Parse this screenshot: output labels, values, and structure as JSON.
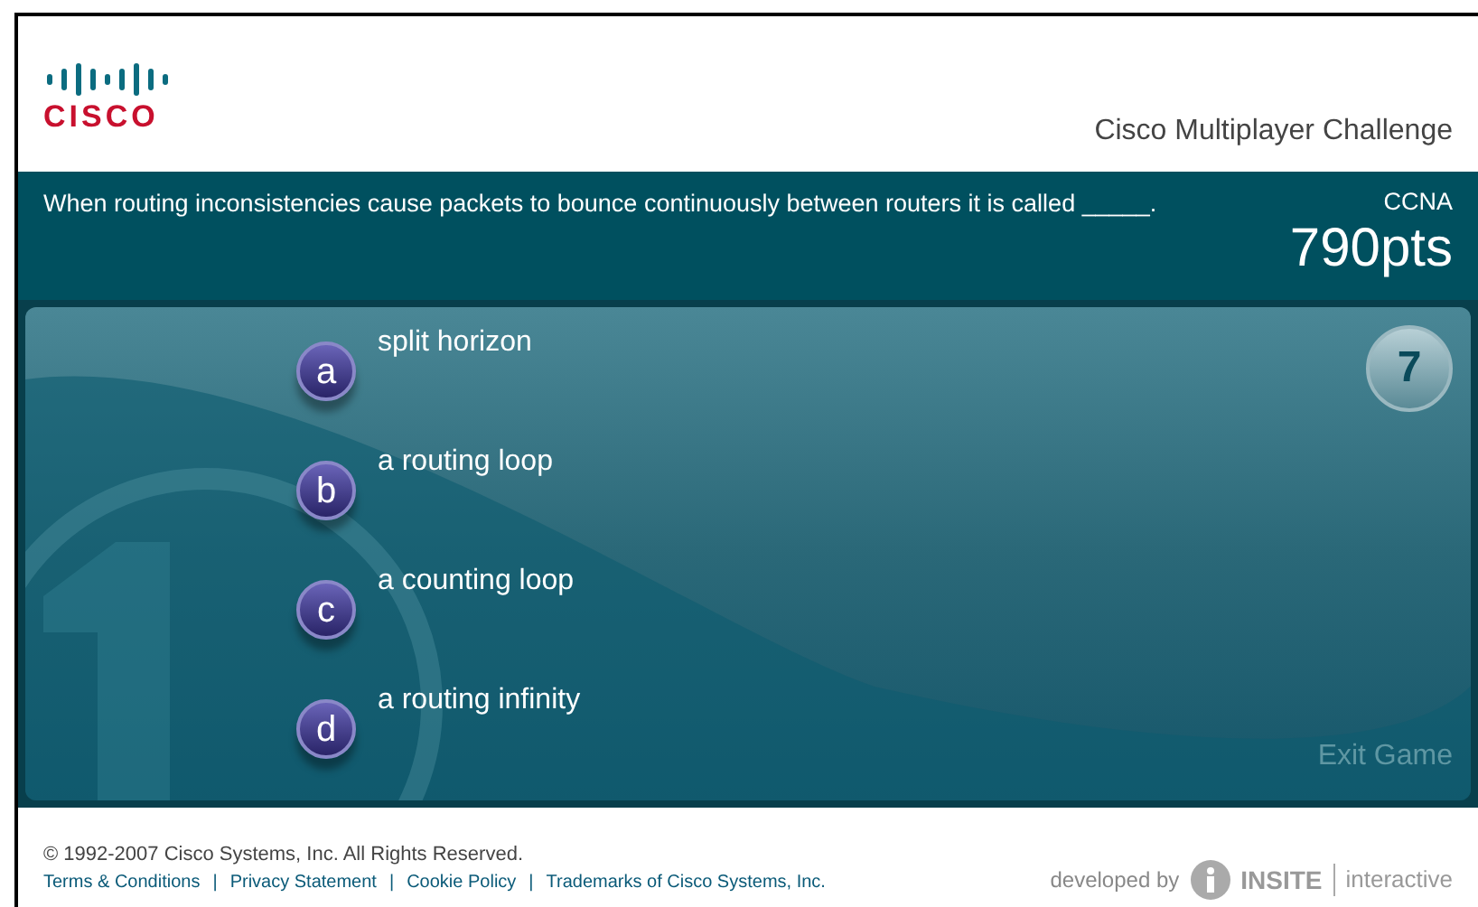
{
  "header": {
    "logo_text": "CISCO",
    "title": "Cisco Multiplayer Challenge"
  },
  "question": {
    "text": "When routing inconsistencies cause packets to bounce continuously between routers it is called _____.",
    "category": "CCNA",
    "score": "790pts"
  },
  "answers": [
    {
      "letter": "a",
      "text": "split horizon"
    },
    {
      "letter": "b",
      "text": "a routing loop"
    },
    {
      "letter": "c",
      "text": "a counting loop"
    },
    {
      "letter": "d",
      "text": "a routing infinity"
    }
  ],
  "timer": "7",
  "exit": "Exit Game",
  "footer": {
    "copyright": "© 1992-2007 Cisco Systems, Inc. All Rights Reserved.",
    "links": [
      "Terms & Conditions",
      "Privacy Statement",
      "Cookie Policy",
      "Trademarks of Cisco Systems, Inc."
    ],
    "separator": "|",
    "developed_by": "developed by",
    "brand": "INSITE",
    "brand_suffix": "interactive"
  }
}
